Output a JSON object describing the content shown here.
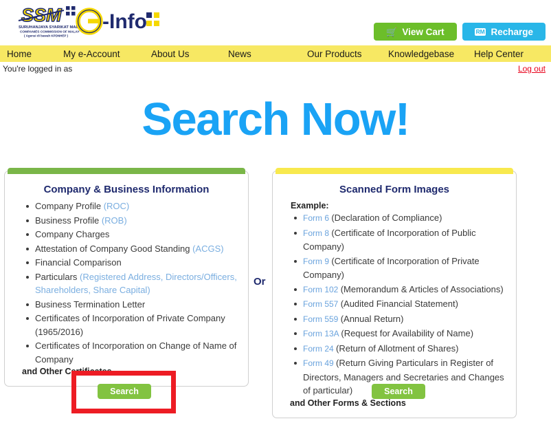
{
  "header": {
    "logo_ssm_alt": "SSM",
    "logo_ssm_sub1": "SURUHANJAYA SYARIKAT MALAYSIA",
    "logo_ssm_sub2": "COMPANIES COMMISSION OF MALAYSIA",
    "logo_ssm_sub3": "( Agensi di bawah KPDNHEP )",
    "logo_einfo_alt": "e-Info",
    "view_cart_label": "View Cart",
    "recharge_label": "Recharge",
    "recharge_badge": "RM",
    "cart_icon": "shopping-cart-icon"
  },
  "nav": {
    "items": [
      {
        "label": "Home"
      },
      {
        "label": "My e-Account"
      },
      {
        "label": "About Us"
      },
      {
        "label": "News"
      },
      {
        "label": "Our Products"
      },
      {
        "label": "Knowledgebase"
      },
      {
        "label": "Help Center"
      }
    ]
  },
  "session": {
    "logged_in_text": "You're logged in as",
    "logout_label": "Log out"
  },
  "hero": {
    "title": "Search Now!"
  },
  "or_label": "Or",
  "left_panel": {
    "title": "Company & Business Information",
    "accent_color": "#7ab648",
    "items": [
      {
        "text": "Company Profile ",
        "sub": "(ROC)"
      },
      {
        "text": "Business Profile ",
        "sub": "(ROB)"
      },
      {
        "text": "Company Charges",
        "sub": ""
      },
      {
        "text": "Attestation of Company Good Standing ",
        "sub": "(ACGS)"
      },
      {
        "text": "Financial Comparison",
        "sub": ""
      },
      {
        "text": "Particulars ",
        "sub": "(Registered Address, Directors/Officers, Shareholders, Share Capital)"
      },
      {
        "text": "Business Termination Letter",
        "sub": ""
      },
      {
        "text": "Certificates of Incorporation of Private Company (1965/2016)",
        "sub": ""
      },
      {
        "text": "Certificates of Incorporation on Change of Name of Company",
        "sub": ""
      }
    ],
    "footer_note": "and Other Certificates",
    "search_label": "Search"
  },
  "right_panel": {
    "title": "Scanned Form Images",
    "accent_color": "#f8e94e",
    "example_label": "Example:",
    "items": [
      {
        "form": "Form 6 ",
        "desc": "(Declaration of Compliance)"
      },
      {
        "form": "Form 8 ",
        "desc": "(Certificate of Incorporation of Public Company)"
      },
      {
        "form": "Form 9 ",
        "desc": "(Certificate of Incorporation of Private Company)"
      },
      {
        "form": "Form 102 ",
        "desc": "(Memorandum & Articles of Associations)"
      },
      {
        "form": "Form 557 ",
        "desc": "(Audited Financial Statement)"
      },
      {
        "form": "Form 559 ",
        "desc": "(Annual Return)"
      },
      {
        "form": "Form 13A ",
        "desc": "(Request for Availability of Name)"
      },
      {
        "form": "Form 24 ",
        "desc": "(Return of Allotment of Shares)"
      },
      {
        "form": "Form 49 ",
        "desc": "(Return Giving Particulars in Register of Directors, Managers and Secretaries and Changes of particular)"
      }
    ],
    "footer_note": "and Other Forms & Sections",
    "search_label": "Search"
  },
  "highlight": {
    "color": "#ed1c24",
    "target": "left-search-button"
  }
}
